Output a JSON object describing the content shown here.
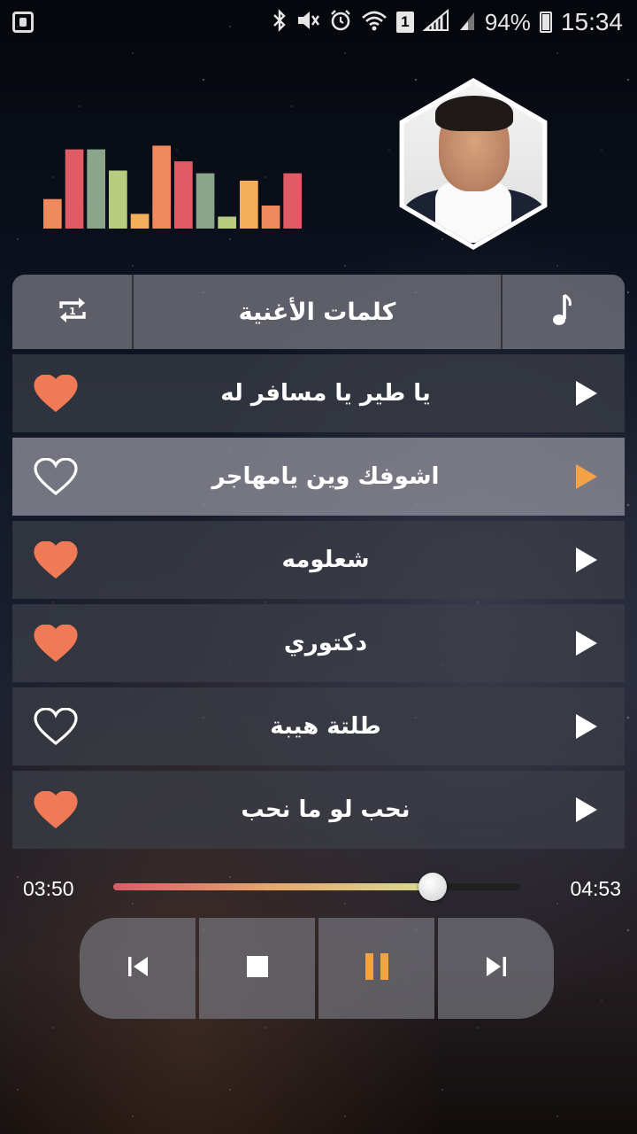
{
  "status_bar": {
    "battery": "94%",
    "time": "15:34",
    "sim_slot": "1"
  },
  "equalizer": {
    "bars": [
      {
        "level": 0.32,
        "color": "#f08a5d"
      },
      {
        "level": 0.86,
        "color": "#e05b66"
      },
      {
        "level": 0.86,
        "color": "#8aa58a"
      },
      {
        "level": 0.63,
        "color": "#b7cc7e"
      },
      {
        "level": 0.16,
        "color": "#f4ae5a"
      },
      {
        "level": 0.9,
        "color": "#f08a5d"
      },
      {
        "level": 0.73,
        "color": "#e05b66"
      },
      {
        "level": 0.6,
        "color": "#8aa58a"
      },
      {
        "level": 0.13,
        "color": "#b7cc7e"
      },
      {
        "level": 0.52,
        "color": "#f4ae5a"
      },
      {
        "level": 0.25,
        "color": "#f08a5d"
      },
      {
        "level": 0.6,
        "color": "#e05b66"
      }
    ]
  },
  "tabs": {
    "lyrics_label": "كلمات الأغنية"
  },
  "songs": [
    {
      "title": "يا طير يا مسافر له",
      "favorite": true,
      "active": false
    },
    {
      "title": "اشوفك وين يامهاجر",
      "favorite": false,
      "active": true
    },
    {
      "title": "شعلومه",
      "favorite": true,
      "active": false
    },
    {
      "title": "دكتوري",
      "favorite": true,
      "active": false
    },
    {
      "title": "طلتة هيبة",
      "favorite": false,
      "active": false
    },
    {
      "title": "نحب لو ما نحب",
      "favorite": true,
      "active": false
    }
  ],
  "player": {
    "current_time": "03:50",
    "total_time": "04:53",
    "progress": 0.785
  },
  "colors": {
    "heart_fill": "#f07a55",
    "active_play": "#f4a246",
    "pause_icon": "#f4a246"
  },
  "icons": {
    "repeat": "repeat-one-icon",
    "music": "music-note-icon",
    "favorite": "heart-icon",
    "play": "play-icon",
    "previous": "skip-previous-icon",
    "stop": "stop-icon",
    "pause": "pause-icon",
    "next": "skip-next-icon"
  }
}
